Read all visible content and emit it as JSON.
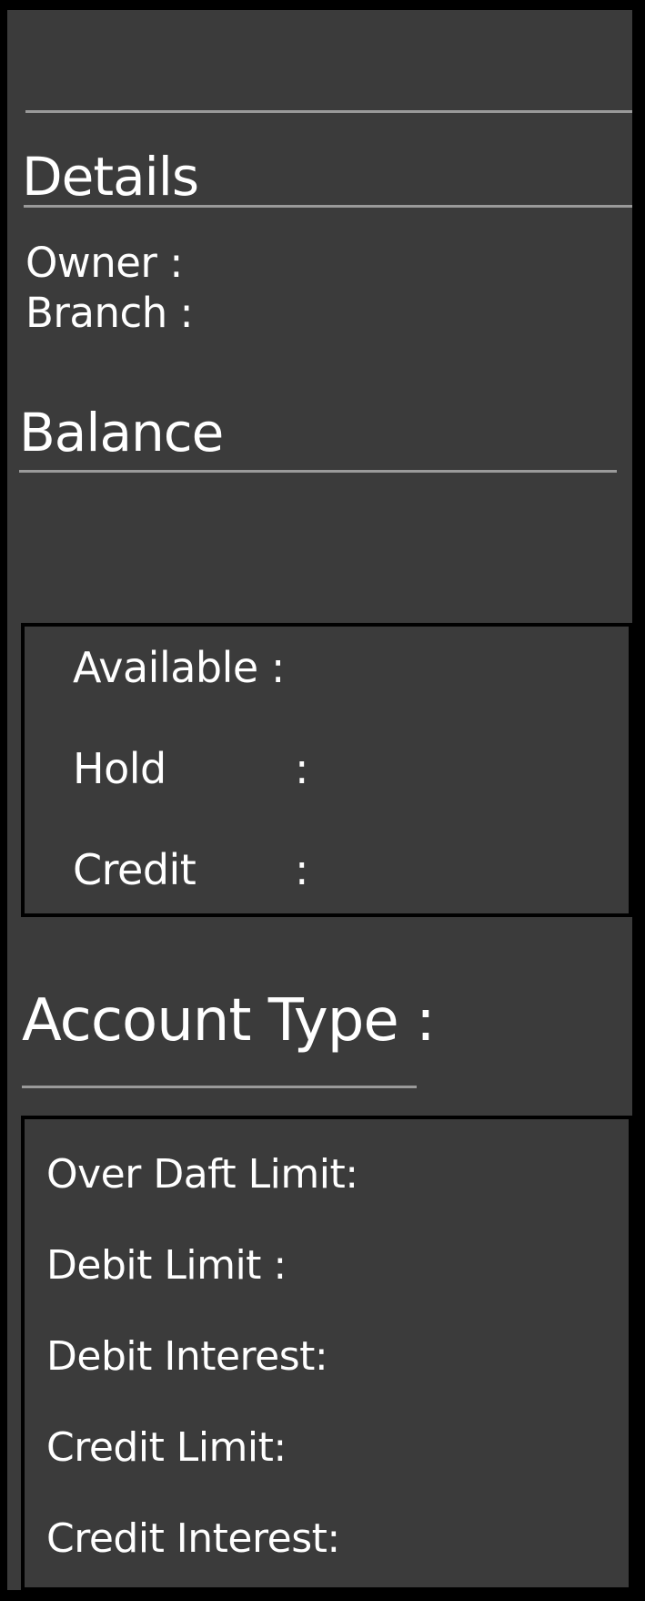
{
  "details": {
    "heading": "Details",
    "owner_label": "Owner :",
    "branch_label": "Branch :"
  },
  "balance": {
    "heading": "Balance",
    "available_label": "Available :",
    "hold_label": "Hold",
    "credit_label": "Credit",
    "separator": ":"
  },
  "account_type": {
    "heading": "Account Type :",
    "overdraft_limit_label": "Over Daft Limit:",
    "debit_limit_label": "Debit Limit :",
    "debit_interest_label": "Debit Interest:",
    "credit_limit_label": "Credit Limit:",
    "credit_interest_label": "Credit Interest:"
  },
  "colors": {
    "panel_background": "#3b3b3b",
    "frame": "#000000",
    "divider": "#9a9a9a",
    "text": "#ffffff"
  }
}
